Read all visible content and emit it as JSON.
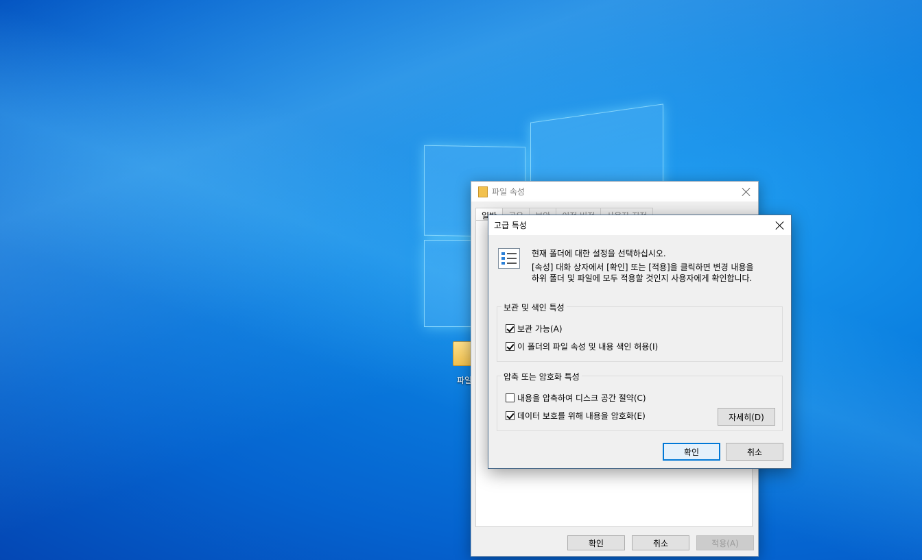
{
  "desktop": {
    "icon_label": "파일"
  },
  "props_dialog": {
    "title": "파일 속성",
    "tabs": [
      "일반",
      "공유",
      "보안",
      "이전 버전",
      "사용자 지정"
    ],
    "ok": "확인",
    "cancel": "취소",
    "apply": "적용(A)"
  },
  "adv_dialog": {
    "title": "고급 특성",
    "intro_line1": "현재 폴더에 대한 설정을 선택하십시오.",
    "intro_line2": "[속성] 대화 상자에서 [확인] 또는 [적용]을 클릭하면 변경 내용을",
    "intro_line3": "하위 폴더 및 파일에 모두 적용할 것인지 사용자에게 확인합니다.",
    "group1": {
      "legend": "보관 및 색인 특성",
      "archive": {
        "label": "보관 가능(A)",
        "checked": true
      },
      "index": {
        "label": "이 폴더의 파일 속성 및 내용 색인 허용(I)",
        "checked": true
      }
    },
    "group2": {
      "legend": "압축 또는 암호화 특성",
      "compress": {
        "label": "내용을 압축하여 디스크 공간 절약(C)",
        "checked": false
      },
      "encrypt": {
        "label": "데이터 보호를 위해 내용을 암호화(E)",
        "checked": true
      },
      "details": "자세히(D)"
    },
    "ok": "확인",
    "cancel": "취소"
  }
}
